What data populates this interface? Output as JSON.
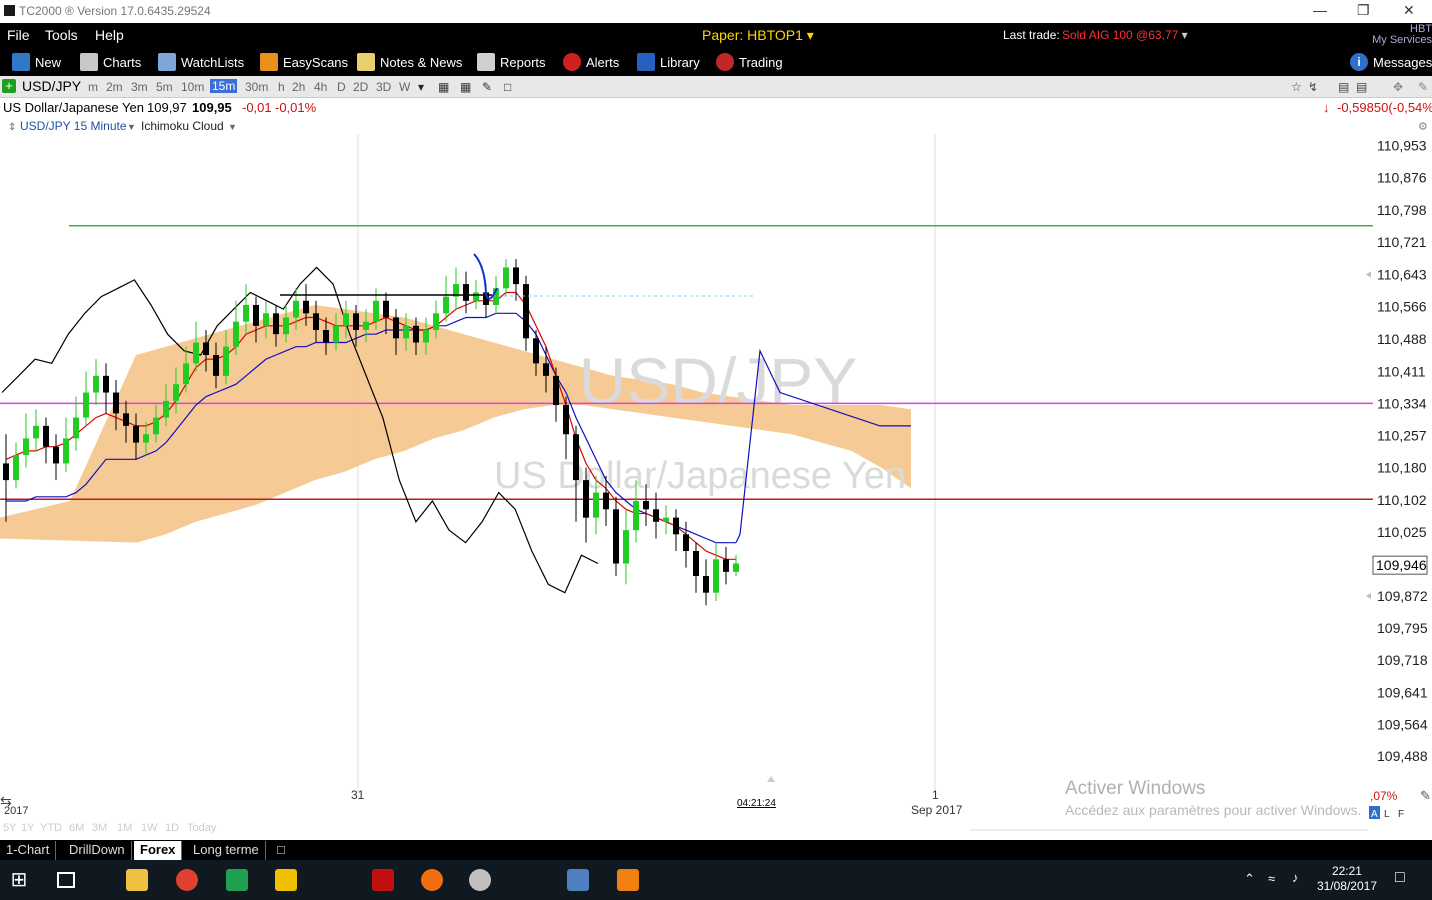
{
  "window": {
    "title": "TC2000 ® Version 17.0.6435.29524"
  },
  "menu": {
    "items": [
      "File",
      "Tools",
      "Help"
    ],
    "paper": "Paper: HBTOP1",
    "last_trade_label": "Last trade:",
    "last_trade_value": "Sold AIG 100 @63,77",
    "hbt": "HBT",
    "my_services": "My Services"
  },
  "toolbar": {
    "new": "New",
    "charts": "Charts",
    "watchlists": "WatchLists",
    "easyscans": "EasyScans",
    "notes": "Notes & News",
    "reports": "Reports",
    "alerts": "Alerts",
    "library": "Library",
    "trading": "Trading",
    "messages": "Messages"
  },
  "timeframes": {
    "symbol": "USD/JPY",
    "items": [
      "m",
      "2m",
      "3m",
      "5m",
      "10m",
      "15m",
      "30m",
      "h",
      "2h",
      "4h",
      "D",
      "2D",
      "3D",
      "W"
    ],
    "selected": "15m"
  },
  "quote": {
    "name": "US Dollar/Japanese Yen",
    "bid": "109,97",
    "last": "109,95",
    "change": "-0,01",
    "change_pct": "-0,01%",
    "right_change": "-0,59850(-0,54%)"
  },
  "chart_header": {
    "symbol_tf": "USD/JPY 15 Minute",
    "indicator": "Ichimoku Cloud"
  },
  "watermark": {
    "symbol": "USD/JPY",
    "name": "US Dollar/Japanese Yen"
  },
  "time_labels": {
    "left_year": "2017",
    "day31": "31",
    "day1": "1",
    "sep": "Sep 2017",
    "cursor_time": "04:21:24"
  },
  "activate": {
    "title": "Activer Windows",
    "subtitle": "Accédez aux paramètres pour activer Windows."
  },
  "right_bottom": {
    "pct": ",07%",
    "a": "A",
    "l": "L",
    "f": "F"
  },
  "period_tabs": [
    "5Y",
    "1Y",
    "YTD",
    "6M",
    "3M",
    "1M",
    "1W",
    "1D",
    "Today"
  ],
  "tabs": {
    "items": [
      "1-Chart",
      "DrillDown",
      "Forex",
      "Long terme"
    ],
    "active": "Forex"
  },
  "taskbar": {
    "time": "22:21",
    "date": "31/08/2017"
  },
  "chart_data": {
    "type": "candlestick",
    "y_ticks": [
      "110,953",
      "110,876",
      "110,798",
      "110,721",
      "110,643",
      "110,566",
      "110,488",
      "110,411",
      "110,334",
      "110,257",
      "110,180",
      "110,102",
      "110,025",
      "109,946",
      "109,872",
      "109,795",
      "109,718",
      "109,641",
      "109,564",
      "109,488"
    ],
    "ylim": [
      109.45,
      110.98
    ],
    "current_price": "109,946",
    "hlines": [
      {
        "name": "green",
        "price": 110.76,
        "color": "#3cb43c"
      },
      {
        "name": "magenta",
        "price": 110.334,
        "color": "#e040e0"
      },
      {
        "name": "red",
        "price": 110.104,
        "color": "#c01820"
      }
    ],
    "colors": {
      "up": "#22cc22",
      "down": "#000000",
      "tenkan": "#e00000",
      "kijun": "#1010c0",
      "chikou": "#000000",
      "cloud": "#f5c48a"
    },
    "candles": [
      [
        110.19,
        110.15,
        110.26,
        110.05
      ],
      [
        110.15,
        110.21,
        110.24,
        110.13
      ],
      [
        110.21,
        110.25,
        110.31,
        110.18
      ],
      [
        110.25,
        110.28,
        110.32,
        110.22
      ],
      [
        110.28,
        110.23,
        110.3,
        110.19
      ],
      [
        110.23,
        110.19,
        110.26,
        110.15
      ],
      [
        110.19,
        110.25,
        110.3,
        110.17
      ],
      [
        110.25,
        110.3,
        110.35,
        110.22
      ],
      [
        110.3,
        110.36,
        110.41,
        110.28
      ],
      [
        110.36,
        110.4,
        110.44,
        110.33
      ],
      [
        110.4,
        110.36,
        110.43,
        110.31
      ],
      [
        110.36,
        110.31,
        110.39,
        110.27
      ],
      [
        110.31,
        110.28,
        110.34,
        110.24
      ],
      [
        110.28,
        110.24,
        110.31,
        110.2
      ],
      [
        110.24,
        110.26,
        110.29,
        110.21
      ],
      [
        110.26,
        110.3,
        110.33,
        110.24
      ],
      [
        110.3,
        110.34,
        110.38,
        110.28
      ],
      [
        110.34,
        110.38,
        110.42,
        110.31
      ],
      [
        110.38,
        110.43,
        110.47,
        110.36
      ],
      [
        110.43,
        110.48,
        110.53,
        110.41
      ],
      [
        110.48,
        110.45,
        110.51,
        110.41
      ],
      [
        110.45,
        110.4,
        110.48,
        110.37
      ],
      [
        110.4,
        110.47,
        110.51,
        110.38
      ],
      [
        110.47,
        110.53,
        110.58,
        110.45
      ],
      [
        110.53,
        110.57,
        110.62,
        110.5
      ],
      [
        110.57,
        110.52,
        110.59,
        110.48
      ],
      [
        110.52,
        110.55,
        110.58,
        110.49
      ],
      [
        110.55,
        110.5,
        110.57,
        110.47
      ],
      [
        110.5,
        110.54,
        110.57,
        110.48
      ],
      [
        110.54,
        110.58,
        110.61,
        110.51
      ],
      [
        110.58,
        110.55,
        110.62,
        110.52
      ],
      [
        110.55,
        110.51,
        110.58,
        110.48
      ],
      [
        110.51,
        110.48,
        110.54,
        110.45
      ],
      [
        110.48,
        110.52,
        110.55,
        110.46
      ],
      [
        110.52,
        110.55,
        110.58,
        110.49
      ],
      [
        110.55,
        110.51,
        110.57,
        110.47
      ],
      [
        110.51,
        110.53,
        110.56,
        110.48
      ],
      [
        110.53,
        110.58,
        110.61,
        110.51
      ],
      [
        110.58,
        110.54,
        110.6,
        110.5
      ],
      [
        110.54,
        110.49,
        110.56,
        110.45
      ],
      [
        110.49,
        110.52,
        110.55,
        110.46
      ],
      [
        110.52,
        110.48,
        110.54,
        110.45
      ],
      [
        110.48,
        110.51,
        110.54,
        110.45
      ],
      [
        110.51,
        110.55,
        110.58,
        110.49
      ],
      [
        110.55,
        110.59,
        110.64,
        110.53
      ],
      [
        110.59,
        110.62,
        110.66,
        110.56
      ],
      [
        110.62,
        110.58,
        110.65,
        110.55
      ],
      [
        110.58,
        110.6,
        110.63,
        110.56
      ],
      [
        110.6,
        110.57,
        110.62,
        110.54
      ],
      [
        110.57,
        110.61,
        110.64,
        110.55
      ],
      [
        110.61,
        110.66,
        110.68,
        110.59
      ],
      [
        110.66,
        110.62,
        110.68,
        110.58
      ],
      [
        110.62,
        110.49,
        110.64,
        110.46
      ],
      [
        110.49,
        110.43,
        110.51,
        110.4
      ],
      [
        110.43,
        110.4,
        110.47,
        110.36
      ],
      [
        110.4,
        110.33,
        110.42,
        110.29
      ],
      [
        110.33,
        110.26,
        110.35,
        110.2
      ],
      [
        110.26,
        110.15,
        110.28,
        110.05
      ],
      [
        110.15,
        110.06,
        110.18,
        110.0
      ],
      [
        110.06,
        110.12,
        110.16,
        110.02
      ],
      [
        110.12,
        110.08,
        110.16,
        110.04
      ],
      [
        110.08,
        109.95,
        110.11,
        109.92
      ],
      [
        109.95,
        110.03,
        110.08,
        109.9
      ],
      [
        110.03,
        110.1,
        110.15,
        110.0
      ],
      [
        110.1,
        110.08,
        110.14,
        110.04
      ],
      [
        110.08,
        110.05,
        110.12,
        110.01
      ],
      [
        110.05,
        110.06,
        110.09,
        110.02
      ],
      [
        110.06,
        110.02,
        110.08,
        109.98
      ],
      [
        110.02,
        109.98,
        110.05,
        109.94
      ],
      [
        109.98,
        109.92,
        110.0,
        109.88
      ],
      [
        109.92,
        109.88,
        109.96,
        109.85
      ],
      [
        109.88,
        109.96,
        110.0,
        109.86
      ],
      [
        109.96,
        109.93,
        109.99,
        109.9
      ],
      [
        109.93,
        109.95,
        109.97,
        109.92
      ]
    ],
    "tenkan": [
      110.2,
      110.21,
      110.22,
      110.22,
      110.23,
      110.23,
      110.24,
      110.26,
      110.28,
      110.3,
      110.31,
      110.3,
      110.29,
      110.28,
      110.28,
      110.29,
      110.31,
      110.34,
      110.38,
      110.42,
      110.44,
      110.44,
      110.45,
      110.47,
      110.5,
      110.51,
      110.52,
      110.52,
      110.52,
      110.53,
      110.54,
      110.54,
      110.53,
      110.52,
      110.52,
      110.52,
      110.52,
      110.53,
      110.54,
      110.53,
      110.52,
      110.51,
      110.51,
      110.52,
      110.54,
      110.56,
      110.57,
      110.58,
      110.58,
      110.58,
      110.6,
      110.6,
      110.57,
      110.52,
      110.47,
      110.4,
      110.33,
      110.25,
      110.19,
      110.15,
      110.13,
      110.1,
      110.08,
      110.07,
      110.07,
      110.06,
      110.05,
      110.04,
      110.02,
      110.0,
      109.98,
      109.97,
      109.96,
      109.96
    ],
    "kijun": [
      110.1,
      110.1,
      110.1,
      110.11,
      110.11,
      110.11,
      110.11,
      110.12,
      110.14,
      110.17,
      110.2,
      110.2,
      110.2,
      110.2,
      110.21,
      110.22,
      110.24,
      110.27,
      110.3,
      110.33,
      110.35,
      110.36,
      110.37,
      110.38,
      110.4,
      110.42,
      110.44,
      110.45,
      110.46,
      110.47,
      110.47,
      110.48,
      110.48,
      110.48,
      110.48,
      110.49,
      110.5,
      110.5,
      110.51,
      110.51,
      110.51,
      110.51,
      110.51,
      110.52,
      110.52,
      110.53,
      110.54,
      110.54,
      110.54,
      110.55,
      110.55,
      110.55,
      110.53,
      110.5,
      110.45,
      110.4,
      110.36,
      110.3,
      110.25,
      110.2,
      110.15,
      110.12,
      110.1,
      110.08,
      110.07,
      110.06,
      110.05,
      110.04,
      110.03,
      110.02,
      110.01,
      110.0,
      110.0,
      110.0
    ],
    "chikou": [
      110.36,
      110.4,
      110.44,
      110.43,
      110.5,
      110.55,
      110.59,
      110.61,
      110.63,
      110.57,
      110.5,
      110.46,
      110.45,
      110.52,
      110.56,
      110.6,
      110.58,
      110.56,
      110.62,
      110.66,
      110.62,
      110.5,
      110.4,
      110.3,
      110.15,
      110.05,
      110.1,
      110.03,
      110.0,
      110.05,
      110.12,
      110.08,
      109.98,
      109.9,
      109.88,
      109.97,
      109.95
    ],
    "cloud_top": [
      110.45,
      110.47,
      110.49,
      110.51,
      110.53,
      110.55,
      110.57,
      110.56,
      110.55,
      110.54,
      110.52,
      110.5,
      110.48,
      110.46,
      110.44,
      110.42,
      110.4,
      110.39,
      110.38,
      110.36,
      110.35,
      110.34,
      110.33,
      110.33,
      110.33,
      110.33,
      110.32
    ],
    "cloud_bottom": [
      110.0,
      110.02,
      110.05,
      110.07,
      110.09,
      110.12,
      110.15,
      110.17,
      110.2,
      110.22,
      110.25,
      110.27,
      110.3,
      110.32,
      110.33,
      110.33,
      110.32,
      110.31,
      110.3,
      110.29,
      110.28,
      110.27,
      110.26,
      110.24,
      110.22,
      110.18,
      110.13
    ]
  }
}
